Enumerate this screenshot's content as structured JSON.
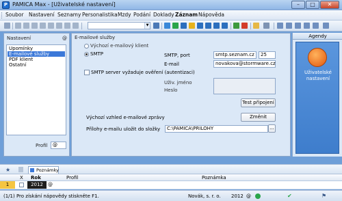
{
  "window": {
    "title": "PAMICA Max - [Uživatelské nastavení]",
    "icon": "pamica-app-icon"
  },
  "menu": {
    "items": [
      "Soubor",
      "Nastavení",
      "Seznamy",
      "Personalistika",
      "Mzdy",
      "Podání",
      "Doklady",
      "Záznam",
      "Nápověda"
    ]
  },
  "toolbar": {
    "combo_value": ""
  },
  "left": {
    "group_label": "Nastavení",
    "at_symbol": "@",
    "list": [
      "Upomínky",
      "E-mailové služby",
      "PDF klient",
      "Ostatní"
    ],
    "selected_index": 1,
    "profil_label": "Profil",
    "profil_value": "@"
  },
  "email": {
    "group_label": "E-mailové služby",
    "radio_default": "Výchozí e-mailový klient",
    "radio_smtp": "SMTP",
    "smtp_label": "SMTP, port",
    "smtp_host": "smtp.seznam.cz",
    "smtp_port": "25",
    "email_label": "E-mail",
    "email_value": "novakova@stormware.cz",
    "auth_checkbox": "SMTP server vyžaduje ověření (autentizaci)",
    "user_label": "Uživ. jméno",
    "password_label": "Heslo",
    "test_button": "Test připojení",
    "template_label": "Výchozí vzhled e-mailové zprávy",
    "change_button": "Změnit",
    "attach_label": "Přílohy e-mailu uložit do složky",
    "attach_path": "C:\\PAMICA\\PRILOHY",
    "browse_button": "..."
  },
  "agendy": {
    "header": "Agendy",
    "tile_label_1": "Uživatelské",
    "tile_label_2": "nastavení"
  },
  "bottom": {
    "tab_label": "Poznámky"
  },
  "grid": {
    "headers": {
      "x": "X",
      "rok": "Rok",
      "profil": "Profil",
      "poznamka": "Poznámka"
    },
    "row": {
      "num": "1",
      "rok": "2012",
      "profil": "@"
    }
  },
  "status": {
    "hint": "(1/1) Pro získání nápovědy stiskněte F1.",
    "company": "Novák, s. r. o.",
    "year": "2012",
    "at": "@"
  }
}
